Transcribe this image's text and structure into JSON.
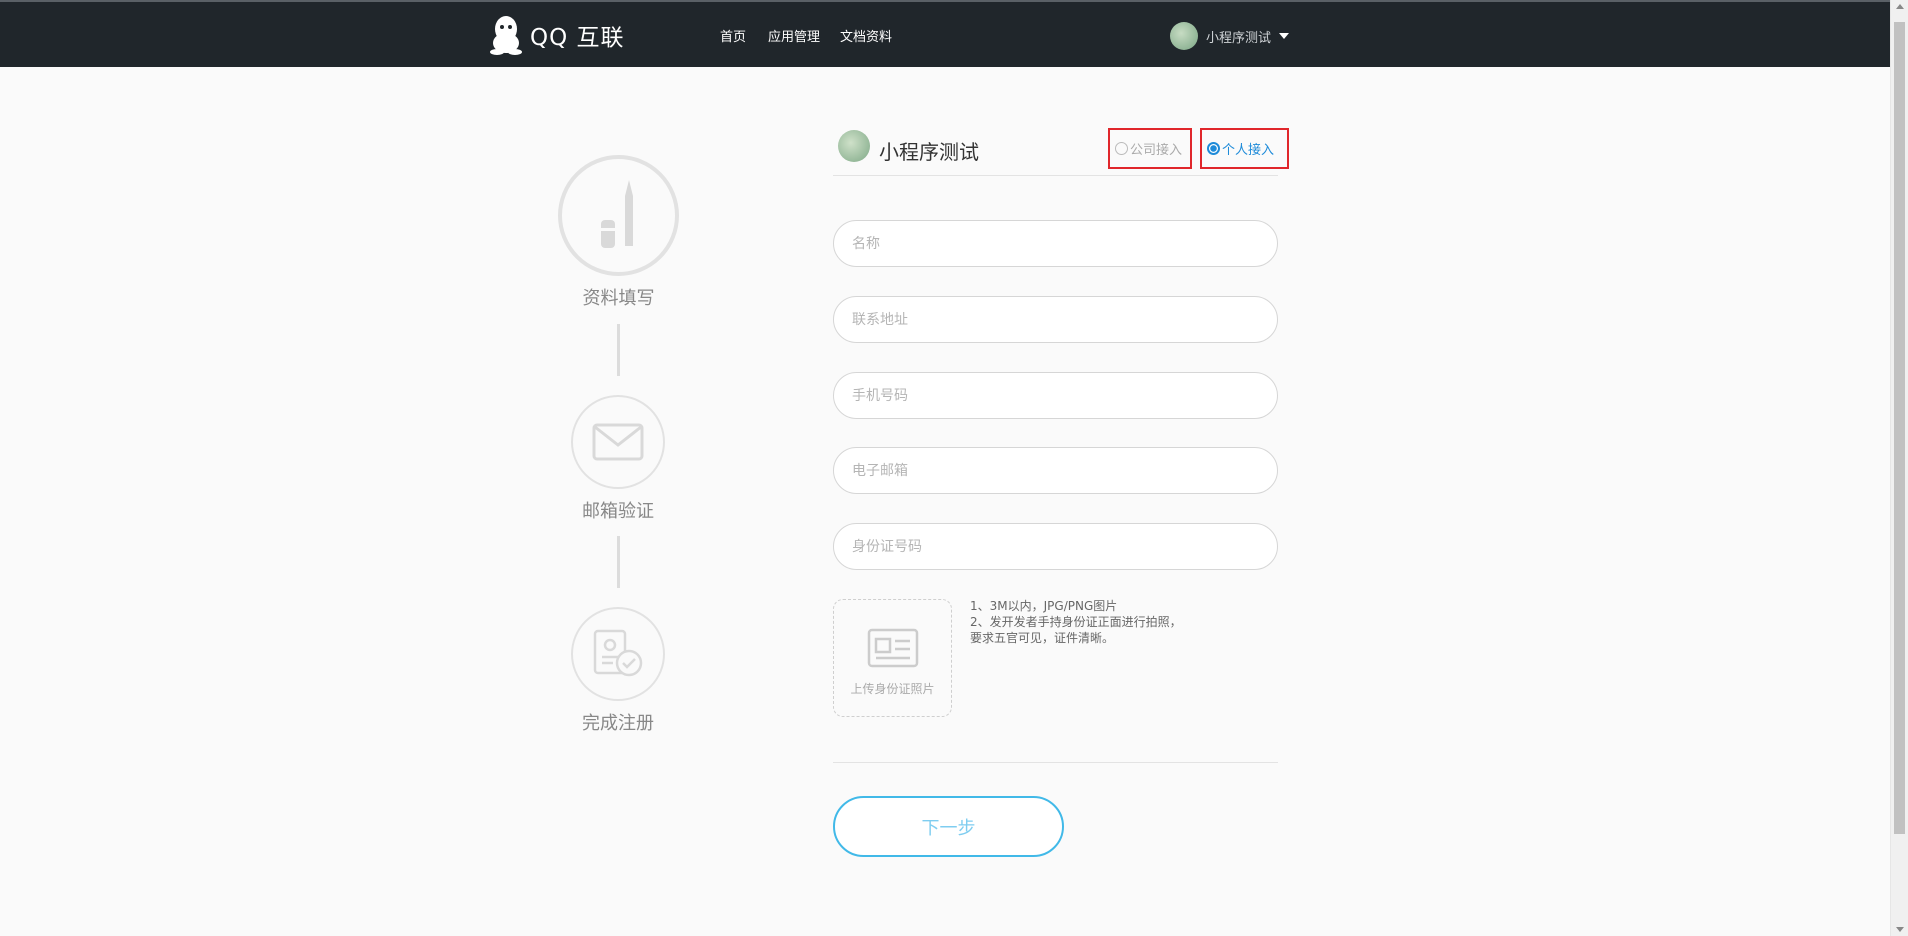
{
  "header": {
    "brand": "QQ 互联",
    "nav": [
      "首页",
      "应用管理",
      "文档资料"
    ],
    "user_name": "小程序测试"
  },
  "steps": [
    {
      "label": "资料填写",
      "icon": "pen-icon"
    },
    {
      "label": "邮箱验证",
      "icon": "envelope-icon"
    },
    {
      "label": "完成注册",
      "icon": "document-check-icon"
    }
  ],
  "form": {
    "app_name": "小程序测试",
    "access_types": [
      {
        "label": "公司接入",
        "selected": false
      },
      {
        "label": "个人接入",
        "selected": true
      }
    ],
    "fields": [
      {
        "placeholder": "名称",
        "value": ""
      },
      {
        "placeholder": "联系地址",
        "value": ""
      },
      {
        "placeholder": "手机号码",
        "value": ""
      },
      {
        "placeholder": "电子邮箱",
        "value": ""
      },
      {
        "placeholder": "身份证号码",
        "value": ""
      }
    ],
    "upload_label": "上传身份证照片",
    "hints": [
      "1、3M以内，JPG/PNG图片",
      "2、发开发者手持身份证正面进行拍照，",
      "要求五官可见，证件清晰。"
    ],
    "next_label": "下一步"
  },
  "colors": {
    "topbar": "#20262b",
    "accent": "#1e8bd9",
    "highlight_box": "#e0262b",
    "button_border": "#41b9e8"
  }
}
